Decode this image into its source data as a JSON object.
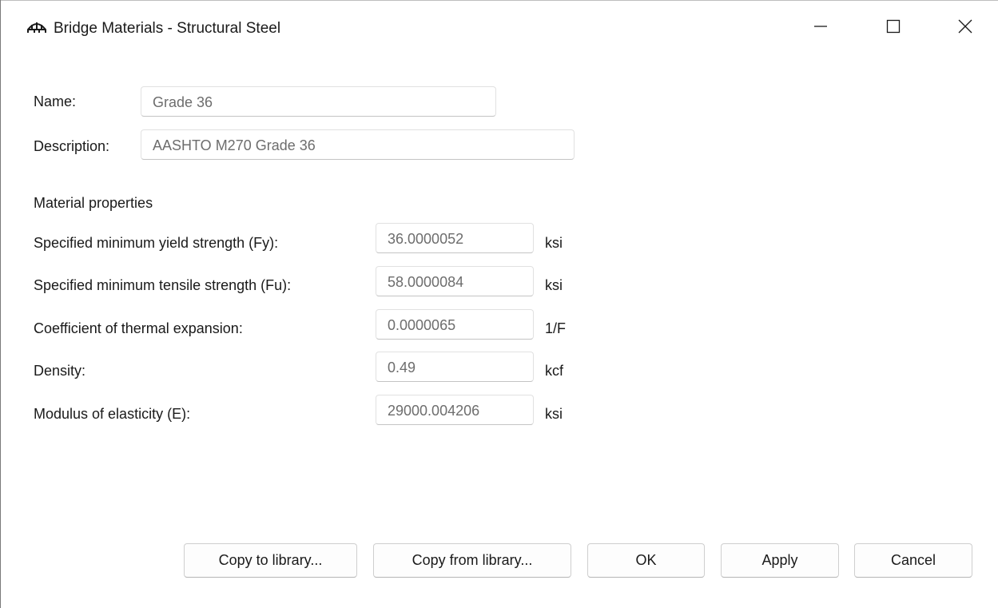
{
  "window": {
    "title": "Bridge Materials - Structural Steel",
    "icon": "bridge-arch-icon",
    "controls": [
      "minimize-icon",
      "maximize-icon",
      "close-icon"
    ]
  },
  "form": {
    "name_label": "Name:",
    "name_value": "Grade 36",
    "description_label": "Description:",
    "description_value": "AASHTO M270 Grade 36"
  },
  "material": {
    "section_label": "Material properties",
    "rows": [
      {
        "label": "Specified minimum yield strength (Fy):",
        "value": "36.0000052",
        "unit": "ksi"
      },
      {
        "label": "Specified minimum tensile strength (Fu):",
        "value": "58.0000084",
        "unit": "ksi"
      },
      {
        "label": "Coefficient of thermal expansion:",
        "value": "0.0000065",
        "unit": "1/F"
      },
      {
        "label": "Density:",
        "value": "0.49",
        "unit": "kcf"
      },
      {
        "label": "Modulus of elasticity (E):",
        "value": "29000.004206",
        "unit": "ksi"
      }
    ]
  },
  "buttons": {
    "copy_to_library": "Copy to library...",
    "copy_from_library": "Copy from library...",
    "ok": "OK",
    "apply": "Apply",
    "cancel": "Cancel"
  }
}
